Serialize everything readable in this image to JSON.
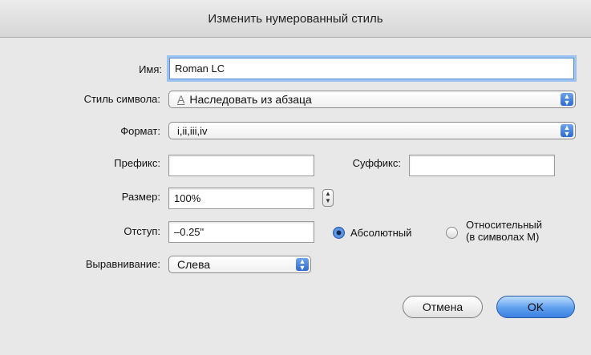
{
  "window": {
    "title": "Изменить нумерованный стиль"
  },
  "form": {
    "name_label": "Имя:",
    "name_value": "Roman LC",
    "char_style_label": "Стиль символа:",
    "char_style_icon": "A",
    "char_style_value": "Наследовать из абзаца",
    "format_label": "Формат:",
    "format_value": "i,ii,iii,iv",
    "prefix_label": "Префикс:",
    "prefix_value": "",
    "suffix_label": "Суффикс:",
    "suffix_value": "",
    "size_label": "Размер:",
    "size_value": "100%",
    "indent_label": "Отступ:",
    "indent_value": "–0.25\"",
    "absolute_label": "Абсолютный",
    "relative_label_line1": "Относительный",
    "relative_label_line2": "(в символах М)",
    "align_label": "Выравнивание:",
    "align_value": "Слева",
    "selected_indent_mode": "absolute"
  },
  "buttons": {
    "cancel": "Отмена",
    "ok": "OK"
  },
  "colors": {
    "focus_ring": "#9cc2f0",
    "accent": "#3b7fe0"
  }
}
